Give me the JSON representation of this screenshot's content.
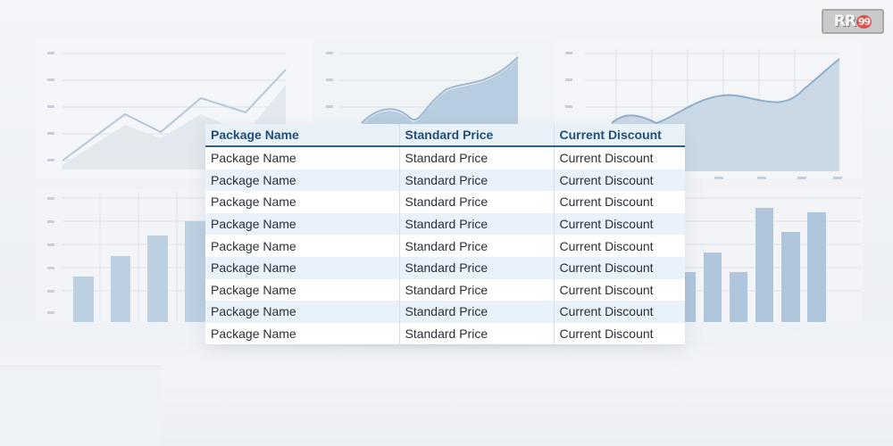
{
  "logo": {
    "text": "RR",
    "badge": "99"
  },
  "table": {
    "headers": [
      "Package Name",
      "Standard Price",
      "Current Discount"
    ],
    "rows": [
      [
        "Package Name",
        "Standard Price",
        "Current Discount"
      ],
      [
        "Package Name",
        "Standard Price",
        "Current Discount"
      ],
      [
        "Package Name",
        "Standard Price",
        "Current Discount"
      ],
      [
        "Package Name",
        "Standard Price",
        "Current Discount"
      ],
      [
        "Package Name",
        "Standard Price",
        "Current Discount"
      ],
      [
        "Package Name",
        "Standard Price",
        "Current Discount"
      ],
      [
        "Package Name",
        "Standard Price",
        "Current Discount"
      ],
      [
        "Package Name",
        "Standard Price",
        "Current Discount"
      ],
      [
        "Package Name",
        "Standard Price",
        "Current Discount"
      ]
    ]
  },
  "colors": {
    "header_text": "#1f4e79",
    "header_rule": "#2d5f8b",
    "stripe": "#e9f1fa",
    "chart_fill": "#b9cde0",
    "chart_line": "#8fb0cc"
  }
}
